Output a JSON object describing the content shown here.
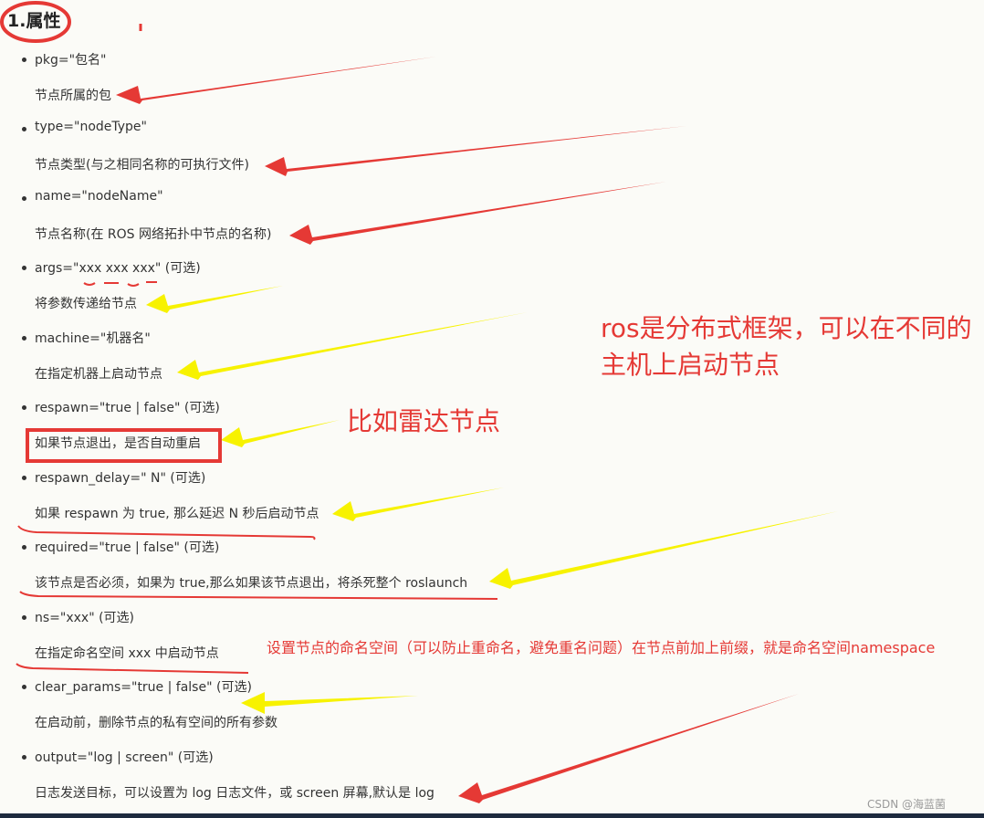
{
  "heading": "1.属性",
  "items": [
    {
      "attr": "pkg=\"包名\"",
      "desc": "节点所属的包"
    },
    {
      "attr": "type=\"nodeType\"",
      "desc": "节点类型(与之相同名称的可执行文件)"
    },
    {
      "attr": "name=\"nodeName\"",
      "desc": "节点名称(在 ROS 网络拓扑中节点的名称)"
    },
    {
      "attr": "args=\"xxx xxx xxx\" (可选)",
      "desc": "将参数传递给节点"
    },
    {
      "attr": "machine=\"机器名\"",
      "desc": "在指定机器上启动节点"
    },
    {
      "attr": "respawn=\"true | false\" (可选)",
      "desc": "如果节点退出，是否自动重启"
    },
    {
      "attr": "respawn_delay=\" N\" (可选)",
      "desc": "如果 respawn 为 true, 那么延迟 N 秒后启动节点"
    },
    {
      "attr": "required=\"true | false\" (可选)",
      "desc": "该节点是否必须，如果为 true,那么如果该节点退出，将杀死整个 roslaunch"
    },
    {
      "attr": "ns=\"xxx\" (可选)",
      "desc": "在指定命名空间 xxx 中启动节点"
    },
    {
      "attr": "clear_params=\"true | false\" (可选)",
      "desc": "在启动前，删除节点的私有空间的所有参数"
    },
    {
      "attr": "output=\"log | screen\" (可选)",
      "desc": "日志发送目标，可以设置为 log 日志文件，或 screen 屏幕,默认是 log"
    }
  ],
  "annotations": {
    "ros_note": "ros是分布式框架，可以在不同的主机上启动节点",
    "radar_note": "比如雷达节点",
    "ns_note": "设置节点的命名空间（可以防止重命名，避免重名问题）在节点前加上前缀，就是命名空间namespace"
  },
  "watermark": "CSDN @海蓝菌",
  "colors": {
    "red": "#e53935",
    "yellow": "#f7f200"
  }
}
